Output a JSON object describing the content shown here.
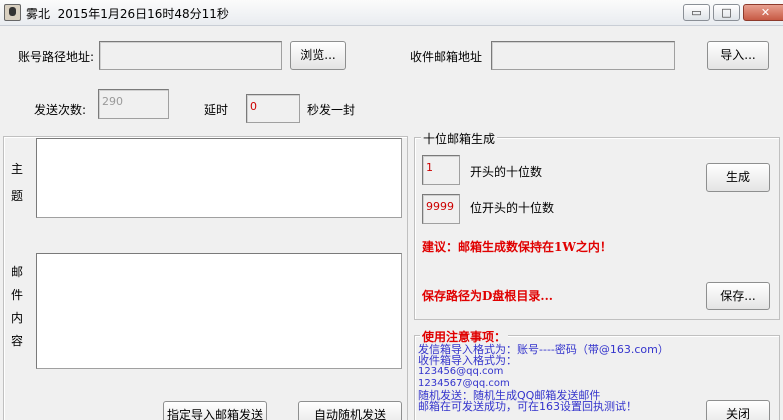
{
  "window": {
    "app_name": "雾北",
    "datetime": "2015年1月26日16时48分11秒",
    "minimize_glyph": "▭",
    "maximize_glyph": "□",
    "close_glyph": "✕"
  },
  "top": {
    "account_path_label": "账号路径地址:",
    "account_path_value": "",
    "browse_label": "浏览...",
    "recipient_label": "收件邮箱地址",
    "recipient_value": "",
    "import_label": "导入...",
    "send_count_label": "发送次数:",
    "send_count_value": "290",
    "delay_label": "延时",
    "delay_value": "0",
    "per_second_label": "秒发一封"
  },
  "compose": {
    "subject_chars": [
      "主",
      "题"
    ],
    "body_chars": [
      "邮",
      "件",
      "内",
      "容"
    ],
    "subject_value": "",
    "body_value": "",
    "import_send_label": "指定导入邮箱发送",
    "auto_random_label": "自动随机发送"
  },
  "generator": {
    "legend": "十位邮箱生成",
    "start_value": "1",
    "start_label": "开头的十位数",
    "count_value": "9999",
    "count_label": "位开头的十位数",
    "generate_label": "生成",
    "suggestion": "建议：邮箱生成数保持在1W之内！",
    "save_path_note": "保存路径为D盘根目录...",
    "save_label": "保存..."
  },
  "notes": {
    "legend": "使用注意事项：",
    "lines": [
      "发信箱导入格式为：账号----密码（带@163.com）",
      "收件箱导入格式为：",
      "123456@qq.com",
      "1234567@qq.com",
      "随机发送：随机生成QQ邮箱发送邮件",
      "邮箱在可发送成功，可在163设置回执测试！"
    ],
    "close_label": "关闭"
  },
  "colors": {
    "accent_red": "#e00000",
    "info_blue": "#3333cc",
    "value_red": "#cc0000"
  }
}
